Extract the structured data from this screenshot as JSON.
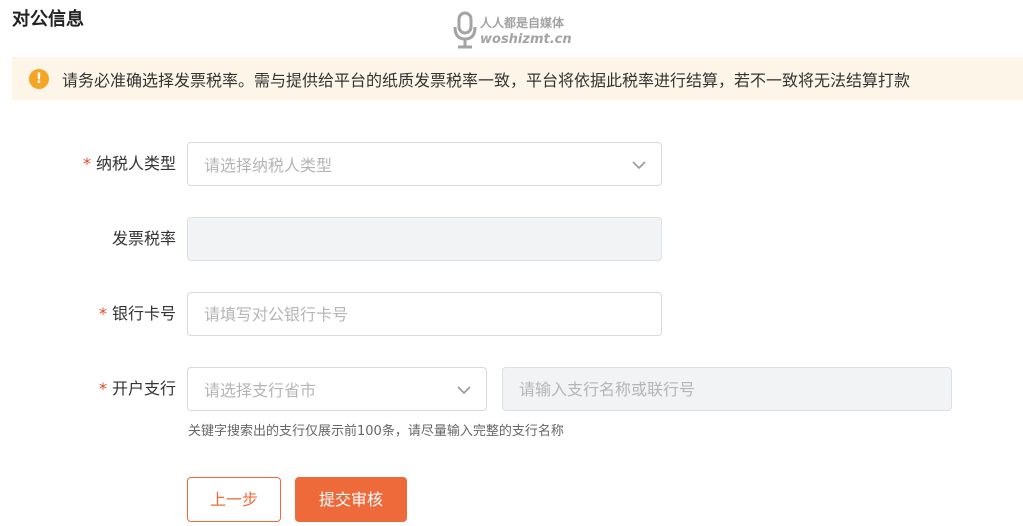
{
  "section": {
    "title": "对公信息"
  },
  "watermark": {
    "line1": "人人都是自媒体",
    "line2": "woshizmt.cn"
  },
  "alert": {
    "icon": "exclamation-icon",
    "icon_glyph": "!",
    "icon_color": "#f5a524",
    "background": "#fdf6e8",
    "text": "请务必准确选择发票税率。需与提供给平台的纸质发票税率一致，平台将依据此税率进行结算，若不一致将无法结算打款"
  },
  "form": {
    "required_mark": "*",
    "taxpayer_type": {
      "label": "纳税人类型",
      "placeholder": "请选择纳税人类型",
      "icon": "chevron-down-icon"
    },
    "invoice_tax_rate": {
      "label": "发票税率",
      "value": ""
    },
    "bank_card": {
      "label": "银行卡号",
      "placeholder": "请填写对公银行卡号"
    },
    "branch": {
      "label": "开户支行",
      "province_placeholder": "请选择支行省市",
      "province_icon": "chevron-down-icon",
      "name_placeholder": "请输入支行名称或联行号",
      "hint": "关键字搜索出的支行仅展示前100条，请尽量输入完整的支行名称"
    }
  },
  "buttons": {
    "prev": "上一步",
    "submit": "提交审核",
    "accent": "#ef6a3a"
  }
}
